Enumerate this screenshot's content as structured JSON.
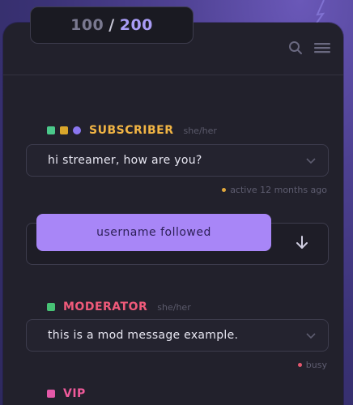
{
  "counter": {
    "current": "100",
    "separator": "/",
    "max": "200"
  },
  "icons": {
    "search": "search-icon",
    "menu": "hamburger-menu-icon"
  },
  "messages": [
    {
      "role": "SUBSCRIBER",
      "role_color": "#f2b544",
      "pronouns": "she/her",
      "text": "hi streamer, how are you?",
      "status": "active 12 months ago",
      "status_color": "#e0a73c",
      "badges": [
        "#4bc98b",
        "#d9a62b",
        "#8a76f0"
      ]
    },
    {
      "role": "MODERATOR",
      "role_color": "#f05a7a",
      "pronouns": "she/her",
      "text": "this is a mod message example.",
      "status": "busy",
      "status_color": "#e4576e",
      "badges": [
        "#47c275"
      ]
    },
    {
      "role": "VIP",
      "role_color": "#f05a9b",
      "badges": [
        "#e458a8"
      ]
    }
  ],
  "follow": {
    "label": "username followed"
  }
}
